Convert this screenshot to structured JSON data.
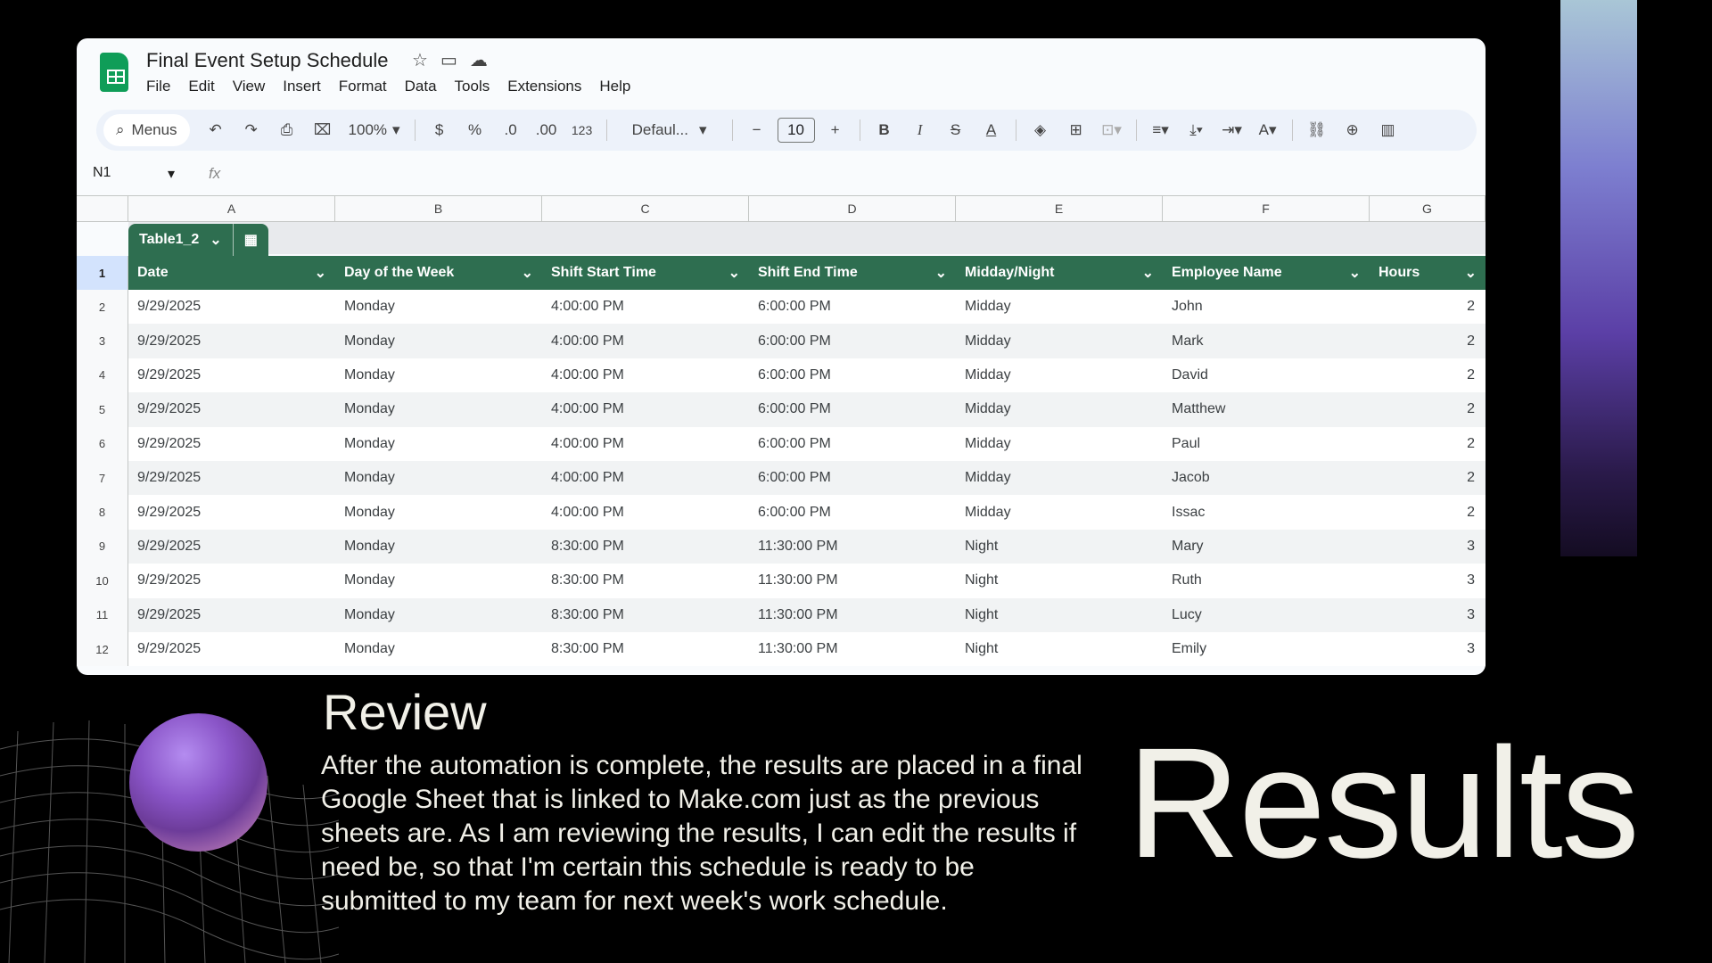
{
  "sheet": {
    "title": "Final Event Setup Schedule",
    "menus": [
      "File",
      "Edit",
      "View",
      "Insert",
      "Format",
      "Data",
      "Tools",
      "Extensions",
      "Help"
    ],
    "toolbar": {
      "search_label": "Menus",
      "zoom": "100%",
      "currency": "$",
      "percent": "%",
      "decrease_decimal": ".0",
      "increase_decimal": ".00",
      "number_format": "123",
      "font": "Defaul...",
      "font_size": "10",
      "bold": "B",
      "italic": "I"
    },
    "name_box": "N1",
    "fx": "fx",
    "column_letters": [
      "A",
      "B",
      "C",
      "D",
      "E",
      "F",
      "G"
    ],
    "table_name": "Table1_2",
    "header_row_number": "1",
    "headers": [
      "Date",
      "Day of the Week",
      "Shift Start Time",
      "Shift End Time",
      "Midday/Night",
      "Employee Name",
      "Hours"
    ],
    "rows": [
      {
        "n": "2",
        "cells": [
          "9/29/2025",
          "Monday",
          "4:00:00 PM",
          "6:00:00 PM",
          "Midday",
          "John",
          "2"
        ]
      },
      {
        "n": "3",
        "cells": [
          "9/29/2025",
          "Monday",
          "4:00:00 PM",
          "6:00:00 PM",
          "Midday",
          "Mark",
          "2"
        ]
      },
      {
        "n": "4",
        "cells": [
          "9/29/2025",
          "Monday",
          "4:00:00 PM",
          "6:00:00 PM",
          "Midday",
          "David",
          "2"
        ]
      },
      {
        "n": "5",
        "cells": [
          "9/29/2025",
          "Monday",
          "4:00:00 PM",
          "6:00:00 PM",
          "Midday",
          "Matthew",
          "2"
        ]
      },
      {
        "n": "6",
        "cells": [
          "9/29/2025",
          "Monday",
          "4:00:00 PM",
          "6:00:00 PM",
          "Midday",
          "Paul",
          "2"
        ]
      },
      {
        "n": "7",
        "cells": [
          "9/29/2025",
          "Monday",
          "4:00:00 PM",
          "6:00:00 PM",
          "Midday",
          "Jacob",
          "2"
        ]
      },
      {
        "n": "8",
        "cells": [
          "9/29/2025",
          "Monday",
          "4:00:00 PM",
          "6:00:00 PM",
          "Midday",
          "Issac",
          "2"
        ]
      },
      {
        "n": "9",
        "cells": [
          "9/29/2025",
          "Monday",
          "8:30:00 PM",
          "11:30:00 PM",
          "Night",
          "Mary",
          "3"
        ]
      },
      {
        "n": "10",
        "cells": [
          "9/29/2025",
          "Monday",
          "8:30:00 PM",
          "11:30:00 PM",
          "Night",
          "Ruth",
          "3"
        ]
      },
      {
        "n": "11",
        "cells": [
          "9/29/2025",
          "Monday",
          "8:30:00 PM",
          "11:30:00 PM",
          "Night",
          "Lucy",
          "3"
        ]
      },
      {
        "n": "12",
        "cells": [
          "9/29/2025",
          "Monday",
          "8:30:00 PM",
          "11:30:00 PM",
          "Night",
          "Emily",
          "3"
        ]
      }
    ],
    "colors": {
      "table_header": "#2e6e50",
      "sheets_green": "#0f9d58"
    }
  },
  "slide": {
    "review_title": "Review",
    "review_body": "After the automation is complete, the results are placed in a final Google Sheet that is linked to Make.com just as the previous sheets are. As I am reviewing the results, I can edit the results if need be, so that I'm certain this schedule is ready to be submitted to my team for next week's work schedule.",
    "big_title": "Results",
    "text_color": "#f1f0e8"
  }
}
